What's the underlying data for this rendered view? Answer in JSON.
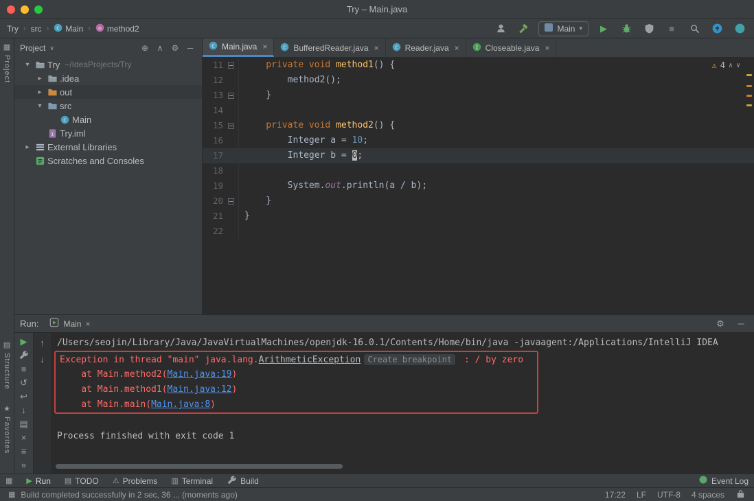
{
  "colors": {
    "accent": "#4A88C7",
    "error": "#FF6B68",
    "link": "#5394EC",
    "error_box": "#C54141",
    "warning": "#E8A33D",
    "run_green": "#5FAD65"
  },
  "window": {
    "title": "Try – Main.java"
  },
  "nav": {
    "breadcrumbs": [
      {
        "label": "Try",
        "icon": null
      },
      {
        "label": "src",
        "icon": null
      },
      {
        "label": "Main",
        "icon": "class"
      },
      {
        "label": "method2",
        "icon": "method"
      }
    ],
    "right_icons": [
      {
        "name": "user-settings-icon",
        "type": "svg",
        "svg": "person",
        "color": "#9DA0A3"
      },
      {
        "name": "build-project-icon",
        "type": "svg",
        "svg": "hammer",
        "color": "#73A859"
      },
      {
        "name": "run-config-select",
        "type": "combo",
        "label": "Main"
      },
      {
        "name": "run-button",
        "type": "glyph",
        "glyph": "▶",
        "color": "#5FAD65"
      },
      {
        "name": "debug-icon",
        "type": "svg",
        "svg": "bug",
        "color": "#5FAD65"
      },
      {
        "name": "coverage-icon",
        "type": "svg",
        "svg": "coverage",
        "color": "#9DA0A3"
      },
      {
        "name": "stop-icon",
        "type": "glyph",
        "glyph": "■",
        "color": "#6E6E6E"
      },
      {
        "name": "search-everywhere-icon",
        "type": "svg",
        "svg": "search",
        "color": "#9DA0A3"
      },
      {
        "name": "update-project-icon",
        "type": "svg",
        "svg": "circleUp",
        "color": "#3592C4"
      },
      {
        "name": "ide-settings-icon",
        "type": "svg",
        "svg": "circle",
        "color": "#41A0A8"
      }
    ]
  },
  "side_strip": {
    "top": {
      "icon": "▦",
      "label": "Project"
    },
    "bottom": [
      {
        "icon": "▤",
        "label": "Structure"
      },
      {
        "icon": "★",
        "label": "Favorites"
      }
    ]
  },
  "project_panel": {
    "title": "Project",
    "header_icons": [
      {
        "name": "locate-file-icon",
        "glyph": "⊕"
      },
      {
        "name": "collapse-all-icon",
        "glyph": "∧"
      },
      {
        "name": "settings-icon",
        "glyph": "⚙"
      },
      {
        "name": "hide-panel-icon",
        "glyph": "─"
      }
    ],
    "tree": [
      {
        "label": "Try",
        "hint": "~/IdeaProjects/Try",
        "depth": 0,
        "chevron": "down",
        "icon": "folder",
        "selected": false
      },
      {
        "label": ".idea",
        "hint": "",
        "depth": 1,
        "chevron": "right",
        "icon": "folder",
        "selected": false
      },
      {
        "label": "out",
        "hint": "",
        "depth": 1,
        "chevron": "right",
        "icon": "folder-out",
        "selected": true
      },
      {
        "label": "src",
        "hint": "",
        "depth": 1,
        "chevron": "down",
        "icon": "folder-src",
        "selected": false
      },
      {
        "label": "Main",
        "hint": "",
        "depth": 2,
        "chevron": "none",
        "icon": "class",
        "selected": false
      },
      {
        "label": "Try.iml",
        "hint": "",
        "depth": 1,
        "chevron": "none",
        "icon": "iml",
        "selected": false
      },
      {
        "label": "External Libraries",
        "hint": "",
        "depth": 0,
        "chevron": "right",
        "icon": "lib",
        "selected": false
      },
      {
        "label": "Scratches and Consoles",
        "hint": "",
        "depth": 0,
        "chevron": "none",
        "icon": "scratch",
        "selected": false
      }
    ]
  },
  "editor": {
    "tabs": [
      {
        "label": "Main.java",
        "icon": "class",
        "active": true
      },
      {
        "label": "BufferedReader.java",
        "icon": "class",
        "active": false
      },
      {
        "label": "Reader.java",
        "icon": "class",
        "active": false
      },
      {
        "label": "Closeable.java",
        "icon": "interface",
        "active": false
      }
    ],
    "inspection": {
      "warnings": "4"
    },
    "code": {
      "lines": [
        {
          "num": 11,
          "fold": true,
          "current": false,
          "tokens": [
            [
              "kw",
              "    private void "
            ],
            [
              "fn",
              "method1"
            ],
            [
              "pl",
              "() {"
            ]
          ]
        },
        {
          "num": 12,
          "fold": false,
          "current": false,
          "tokens": [
            [
              "pl",
              "        method2();"
            ]
          ]
        },
        {
          "num": 13,
          "fold": true,
          "current": false,
          "tokens": [
            [
              "pl",
              "    }"
            ]
          ]
        },
        {
          "num": 14,
          "fold": false,
          "current": false,
          "tokens": []
        },
        {
          "num": 15,
          "fold": true,
          "current": false,
          "tokens": [
            [
              "kw",
              "    private void "
            ],
            [
              "fn",
              "method2"
            ],
            [
              "pl",
              "() {"
            ]
          ]
        },
        {
          "num": 16,
          "fold": false,
          "current": false,
          "tokens": [
            [
              "pl",
              "        Integer a = "
            ],
            [
              "num",
              "10"
            ],
            [
              "pl",
              ";"
            ]
          ]
        },
        {
          "num": 17,
          "fold": false,
          "current": true,
          "tokens": [
            [
              "pl",
              "        Integer b = "
            ],
            [
              "cur",
              "0"
            ],
            [
              "pl",
              ";"
            ]
          ]
        },
        {
          "num": 18,
          "fold": false,
          "current": false,
          "tokens": []
        },
        {
          "num": 19,
          "fold": false,
          "current": false,
          "tokens": [
            [
              "pl",
              "        System."
            ],
            [
              "field",
              "out"
            ],
            [
              "pl",
              ".println(a / b);"
            ]
          ]
        },
        {
          "num": 20,
          "fold": true,
          "current": false,
          "tokens": [
            [
              "pl",
              "    }"
            ]
          ]
        },
        {
          "num": 21,
          "fold": false,
          "current": false,
          "tokens": [
            [
              "pl",
              "}"
            ]
          ]
        },
        {
          "num": 22,
          "fold": false,
          "current": false,
          "tokens": []
        }
      ]
    }
  },
  "run_panel": {
    "label": "Run:",
    "tab": {
      "label": "Main"
    },
    "header_icons": [
      {
        "name": "settings-icon",
        "glyph": "⚙",
        "color": "#9DA0A3"
      },
      {
        "name": "hide-panel-icon",
        "glyph": "─",
        "color": "#9DA0A3"
      }
    ],
    "toolbar_main": [
      {
        "name": "rerun-button",
        "glyph": "▶",
        "color": "#5FAD65"
      },
      {
        "name": "build-button",
        "svg": "wrench",
        "color": "#9DA0A3"
      },
      {
        "name": "stop-button",
        "glyph": "■",
        "color": "#6E6E6E"
      },
      {
        "name": "restore-layout-button",
        "glyph": "↺",
        "color": "#9DA0A3"
      },
      {
        "name": "soft-wrap-button",
        "glyph": "↩",
        "color": "#9DA0A3"
      },
      {
        "name": "scroll-to-end-button",
        "glyph": "↓",
        "color": "#9DA0A3"
      },
      {
        "name": "print-button",
        "glyph": "▤",
        "color": "#9DA0A3"
      },
      {
        "name": "clear-all-button",
        "glyph": "×",
        "color": "#9DA0A3"
      },
      {
        "name": "layout-menu-button",
        "glyph": "≡",
        "color": "#9DA0A3"
      },
      {
        "name": "more-button",
        "glyph": "»",
        "color": "#9DA0A3",
        "pin": true
      }
    ],
    "toolbar_console": [
      {
        "name": "up-stack-trace-button",
        "glyph": "↑",
        "color": "#9DA0A3"
      },
      {
        "name": "down-stack-trace-button",
        "glyph": "↓",
        "color": "#9DA0A3"
      }
    ],
    "console": {
      "lines": [
        {
          "boxed": false,
          "tokens": [
            [
              "con",
              "/Users/seojin/Library/Java/JavaVirtualMachines/openjdk-16.0.1/Contents/Home/bin/java -javaagent:/Applications/IntelliJ IDEA"
            ]
          ]
        },
        {
          "boxed": true,
          "tokens": [
            [
              "err",
              "Exception in thread \"main\" java.lang."
            ],
            [
              "exc",
              "ArithmeticException"
            ],
            [
              "badge",
              "Create breakpoint"
            ],
            [
              "err",
              " : / by zero"
            ]
          ]
        },
        {
          "boxed": true,
          "tokens": [
            [
              "err",
              "    at Main.method2("
            ],
            [
              "lnk",
              "Main.java:19"
            ],
            [
              "err",
              ")"
            ]
          ]
        },
        {
          "boxed": true,
          "tokens": [
            [
              "err",
              "    at Main.method1("
            ],
            [
              "lnk",
              "Main.java:12"
            ],
            [
              "err",
              ")"
            ]
          ]
        },
        {
          "boxed": true,
          "tokens": [
            [
              "err",
              "    at Main.main("
            ],
            [
              "lnk",
              "Main.java:8"
            ],
            [
              "err",
              ")"
            ]
          ]
        },
        {
          "boxed": false,
          "tokens": []
        },
        {
          "boxed": false,
          "tokens": [
            [
              "con",
              "Process finished with exit code 1"
            ]
          ]
        }
      ]
    }
  },
  "bottom_bar": {
    "switcher_icon": "▦",
    "items": [
      {
        "name": "toolwindow-run",
        "label": "Run",
        "glyph": "▶",
        "color": "#5FAD65",
        "active": true
      },
      {
        "name": "toolwindow-todo",
        "label": "TODO",
        "glyph": "▤",
        "color": "#9DA0A3",
        "active": false
      },
      {
        "name": "toolwindow-problems",
        "label": "Problems",
        "glyph": "⚠",
        "color": "#9DA0A3",
        "active": false
      },
      {
        "name": "toolwindow-terminal",
        "label": "Terminal",
        "glyph": "▥",
        "color": "#9DA0A3",
        "active": false
      },
      {
        "name": "toolwindow-build",
        "label": "Build",
        "svg": "wrench",
        "color": "#9DA0A3",
        "active": false
      }
    ],
    "right": {
      "label": "Event Log"
    }
  },
  "status_bar": {
    "message": "Build completed successfully in 2 sec, 36 ... (moments ago)",
    "icon": "▦",
    "right": [
      {
        "name": "status-time",
        "label": "17:22"
      },
      {
        "name": "status-line-separator",
        "label": "LF"
      },
      {
        "name": "status-encoding",
        "label": "UTF-8"
      },
      {
        "name": "status-indent",
        "label": "4 spaces"
      }
    ]
  }
}
